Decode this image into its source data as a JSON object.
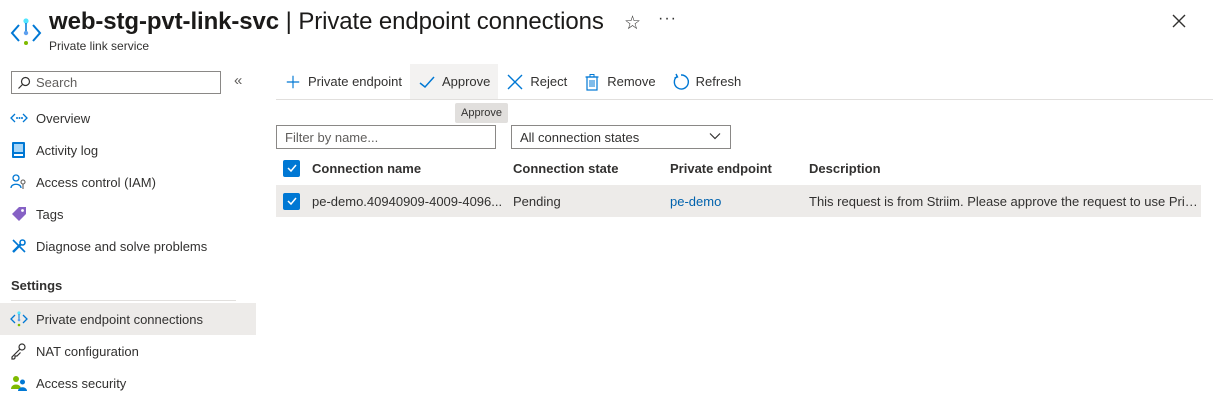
{
  "header": {
    "resource_name": "web-stg-pvt-link-svc",
    "separator": " | ",
    "page_title": "Private endpoint connections",
    "subtitle": "Private link service",
    "favorite_icon": "star-icon",
    "more_icon": "ellipsis-icon",
    "close_icon": "close-icon",
    "more_label": "···"
  },
  "sidebar": {
    "search_placeholder": "Search",
    "collapse_label": "«",
    "items": [
      {
        "label": "Overview",
        "icon": "overview-icon"
      },
      {
        "label": "Activity log",
        "icon": "activity-log-icon"
      },
      {
        "label": "Access control (IAM)",
        "icon": "iam-icon"
      },
      {
        "label": "Tags",
        "icon": "tag-icon"
      },
      {
        "label": "Diagnose and solve problems",
        "icon": "wrench-icon"
      }
    ],
    "section_label": "Settings",
    "settings_items": [
      {
        "label": "Private endpoint connections",
        "icon": "private-link-icon",
        "active": true
      },
      {
        "label": "NAT configuration",
        "icon": "key-icon"
      },
      {
        "label": "Access security",
        "icon": "users-icon"
      }
    ]
  },
  "toolbar": {
    "private_endpoint": "Private endpoint",
    "approve": "Approve",
    "reject": "Reject",
    "remove": "Remove",
    "refresh": "Refresh",
    "tooltip": "Approve"
  },
  "filters": {
    "name_placeholder": "Filter by name...",
    "state_selected": "All connection states"
  },
  "table": {
    "columns": [
      "Connection name",
      "Connection state",
      "Private endpoint",
      "Description"
    ],
    "rows": [
      {
        "name": "pe-demo.40940909-4009-4096...",
        "state": "Pending",
        "endpoint": "pe-demo",
        "description": "This request is from Striim. Please approve the request to use Priva...",
        "selected": true
      }
    ]
  },
  "colors": {
    "accent": "#0078d4",
    "link": "#0062ad",
    "selected_row": "#edebe9"
  }
}
